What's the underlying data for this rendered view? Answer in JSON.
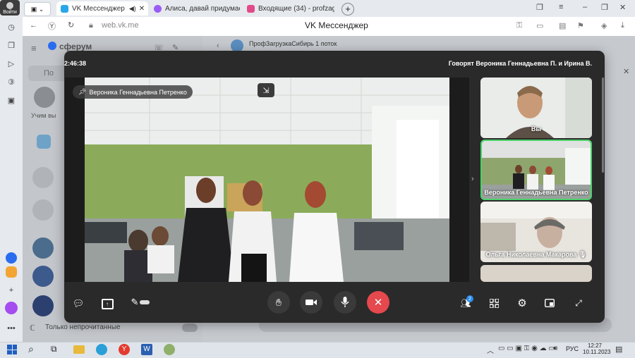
{
  "browser": {
    "login_label": "Войти",
    "tabs": [
      {
        "title": "VK Мессенджер",
        "color": "#2aa7e8"
      },
      {
        "title": "Алиса, давай придумаем",
        "color": "#9b5cf6"
      },
      {
        "title": "Входящие (34) - profzagru",
        "color": "#e24a8a"
      }
    ],
    "address": "web.vk.me",
    "page_title": "VK Мессенджер"
  },
  "vk": {
    "brand": "сферум",
    "search_placeholder": "По",
    "chat_title": "ПрофЗагрузкаСибирь 1 поток",
    "chat_caption": "Учим вы",
    "filter_label": "Только непрочитанные"
  },
  "call": {
    "timer": "2:46:38",
    "speaking": "Говорят Вероника Геннадьевна П. и Ирина В.",
    "pinned_name": "Вероника Геннадьевна Петренко",
    "participants": [
      {
        "name": "Вы",
        "bg": "#9aa9a0"
      },
      {
        "name": "Вероника Геннадьевна Петренко",
        "bg": "#8fa56e",
        "highlight": true
      },
      {
        "name": "Ольга Николаевна Макарова",
        "bg": "#cfc8bc"
      }
    ],
    "participants_count": "2",
    "accent_red": "#e5484d",
    "accent_green": "#4bd269"
  },
  "taskbar": {
    "language": "РУС",
    "time": "12:27",
    "date": "10.11.2023"
  }
}
